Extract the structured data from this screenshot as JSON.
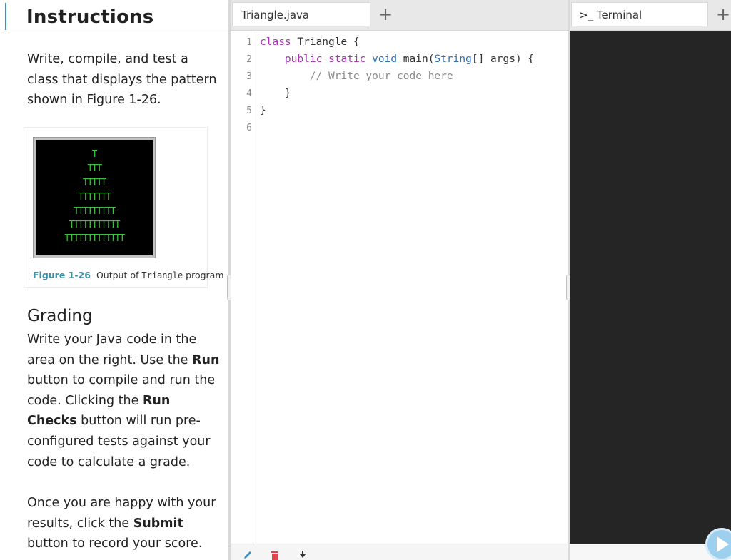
{
  "instructions": {
    "heading": "Instructions",
    "intro": "Write, compile, and test a class that displays the pattern shown in Figure 1-26.",
    "figure": {
      "output_lines": [
        "T",
        "TTT",
        "TTTTT",
        "TTTTTTT",
        "TTTTTTTTT",
        "TTTTTTTTTTT",
        "TTTTTTTTTTTTT"
      ],
      "caption_number": "Figure 1-26",
      "caption_text_1": "Output of ",
      "caption_code": "Triangle",
      "caption_text_2": " program"
    },
    "grading_heading": "Grading",
    "grading_text": {
      "p1": "Write your Java code in the area on the right. Use the ",
      "run": "Run",
      "p2": " button to compile and run the code. Clicking the ",
      "run_checks": "Run Checks",
      "p3": " button will run pre-configured tests against your code to calculate a grade."
    },
    "submit_text": {
      "p1": "Once you are happy with your results, click the ",
      "submit": "Submit",
      "p2": " button to record your score."
    }
  },
  "editor": {
    "tab_label": "Triangle.java",
    "new_tab_glyph": "+",
    "line_numbers": [
      "1",
      "2",
      "3",
      "4",
      "5",
      "6"
    ],
    "code": {
      "l1_kw": "class",
      "l1_rest": " Triangle {",
      "l2_indent": "    ",
      "l2_kw": "public static",
      "l2_sp": " ",
      "l2_ty": "void",
      "l2_mid": " main(",
      "l2_ty2": "String",
      "l2_rest": "[] args) {",
      "l3": "        // Write your code here",
      "l4": "    }",
      "l5": "}"
    },
    "footer_icons": [
      "pencil-icon",
      "trash-icon",
      "download-icon"
    ]
  },
  "terminal": {
    "tab_label": ">_ Terminal",
    "new_tab_glyph": "+"
  },
  "colors": {
    "accent": "#3b8ec7",
    "keyword": "#a335ad",
    "type": "#2b6fb8",
    "comment": "#8a8a8a",
    "terminal_bg": "#252525",
    "figure_output": "#3fbf3f"
  }
}
